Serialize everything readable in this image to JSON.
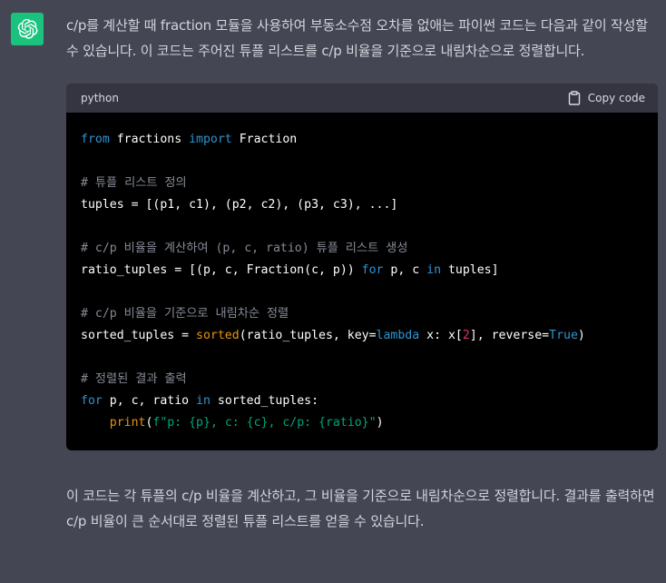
{
  "message": {
    "intro": "c/p를 계산할 때 fraction 모듈을 사용하여 부동소수점 오차를 없애는 파이썬 코드는 다음과 같이 작성할 수 있습니다. 이 코드는 주어진 튜플 리스트를 c/p 비율을 기준으로 내림차순으로 정렬합니다.",
    "outro": "이 코드는 각 튜플의 c/p 비율을 계산하고, 그 비율을 기준으로 내림차순으로 정렬합니다. 결과를 출력하면 c/p 비율이 큰 순서대로 정렬된 튜플 리스트를 얻을 수 있습니다."
  },
  "code": {
    "language": "python",
    "copy_label": "Copy code",
    "lines": [
      [
        {
          "t": "from",
          "c": "kw"
        },
        {
          "t": " fractions ",
          "c": ""
        },
        {
          "t": "import",
          "c": "kw"
        },
        {
          "t": " Fraction",
          "c": ""
        }
      ],
      [],
      [
        {
          "t": "# 튜플 리스트 정의",
          "c": "cm"
        }
      ],
      [
        {
          "t": "tuples = [(p1, c1), (p2, c2), (p3, c3), ...]",
          "c": ""
        }
      ],
      [],
      [
        {
          "t": "# c/p 비율을 계산하여 (p, c, ratio) 튜플 리스트 생성",
          "c": "cm"
        }
      ],
      [
        {
          "t": "ratio_tuples = [(p, c, Fraction(c, p)) ",
          "c": ""
        },
        {
          "t": "for",
          "c": "kw"
        },
        {
          "t": " p, c ",
          "c": ""
        },
        {
          "t": "in",
          "c": "kw"
        },
        {
          "t": " tuples]",
          "c": ""
        }
      ],
      [],
      [
        {
          "t": "# c/p 비율을 기준으로 내림차순 정렬",
          "c": "cm"
        }
      ],
      [
        {
          "t": "sorted_tuples = ",
          "c": ""
        },
        {
          "t": "sorted",
          "c": "fn"
        },
        {
          "t": "(ratio_tuples, key=",
          "c": ""
        },
        {
          "t": "lambda",
          "c": "kw"
        },
        {
          "t": " x: x[",
          "c": ""
        },
        {
          "t": "2",
          "c": "num"
        },
        {
          "t": "], reverse=",
          "c": ""
        },
        {
          "t": "True",
          "c": "kw"
        },
        {
          "t": ")",
          "c": ""
        }
      ],
      [],
      [
        {
          "t": "# 정렬된 결과 출력",
          "c": "cm"
        }
      ],
      [
        {
          "t": "for",
          "c": "kw"
        },
        {
          "t": " p, c, ratio ",
          "c": ""
        },
        {
          "t": "in",
          "c": "kw"
        },
        {
          "t": " sorted_tuples:",
          "c": ""
        }
      ],
      [
        {
          "t": "    ",
          "c": ""
        },
        {
          "t": "print",
          "c": "fn"
        },
        {
          "t": "(",
          "c": ""
        },
        {
          "t": "f\"p: {p}, c: {c}, c/p: {ratio}\"",
          "c": "str"
        },
        {
          "t": ")",
          "c": ""
        }
      ]
    ]
  },
  "colors": {
    "background": "#444654",
    "avatar": "#19c37d",
    "code_background": "#000000",
    "code_header": "#343541"
  },
  "icons": {
    "avatar": "openai-logo-icon",
    "copy": "clipboard-icon"
  }
}
